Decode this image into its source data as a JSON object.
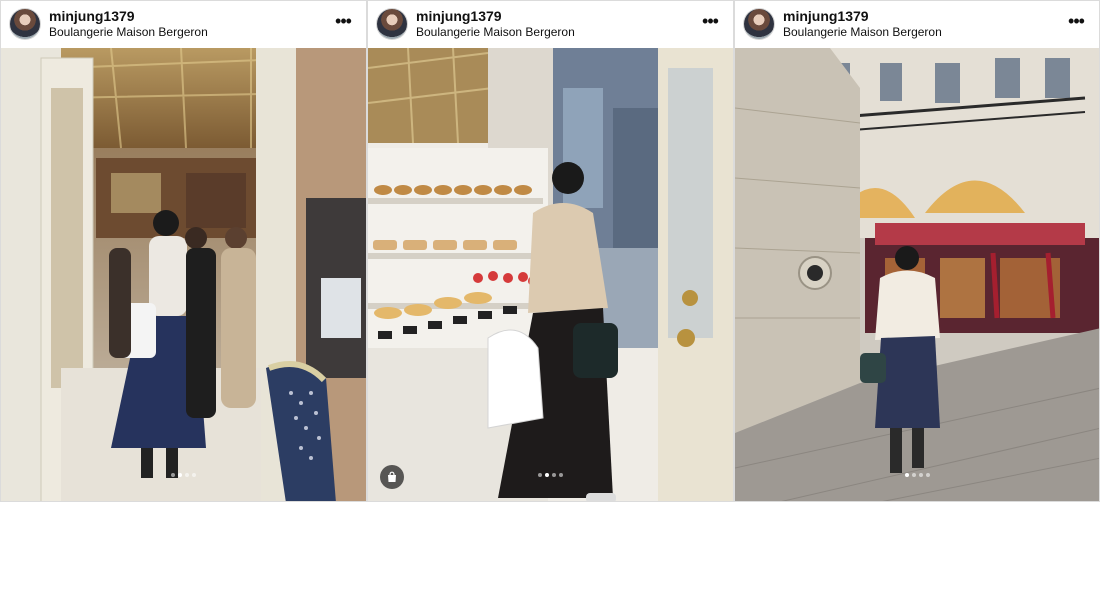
{
  "posts": [
    {
      "username": "minjung1379",
      "location": "Boulangerie Maison Bergeron",
      "more_icon": "more-horizontal-icon",
      "photo": "bakery-doorway",
      "carousel": {
        "count": 4,
        "active": 1
      }
    },
    {
      "username": "minjung1379",
      "location": "Boulangerie Maison Bergeron",
      "more_icon": "more-horizontal-icon",
      "photo": "pastry-display-window",
      "carousel": {
        "count": 4,
        "active": 1
      },
      "badge_icon": "shopping-bag-icon"
    },
    {
      "username": "minjung1379",
      "location": "Boulangerie Maison Bergeron",
      "more_icon": "more-horizontal-icon",
      "photo": "courtyard-street",
      "carousel": {
        "count": 4,
        "active": 0
      }
    }
  ]
}
